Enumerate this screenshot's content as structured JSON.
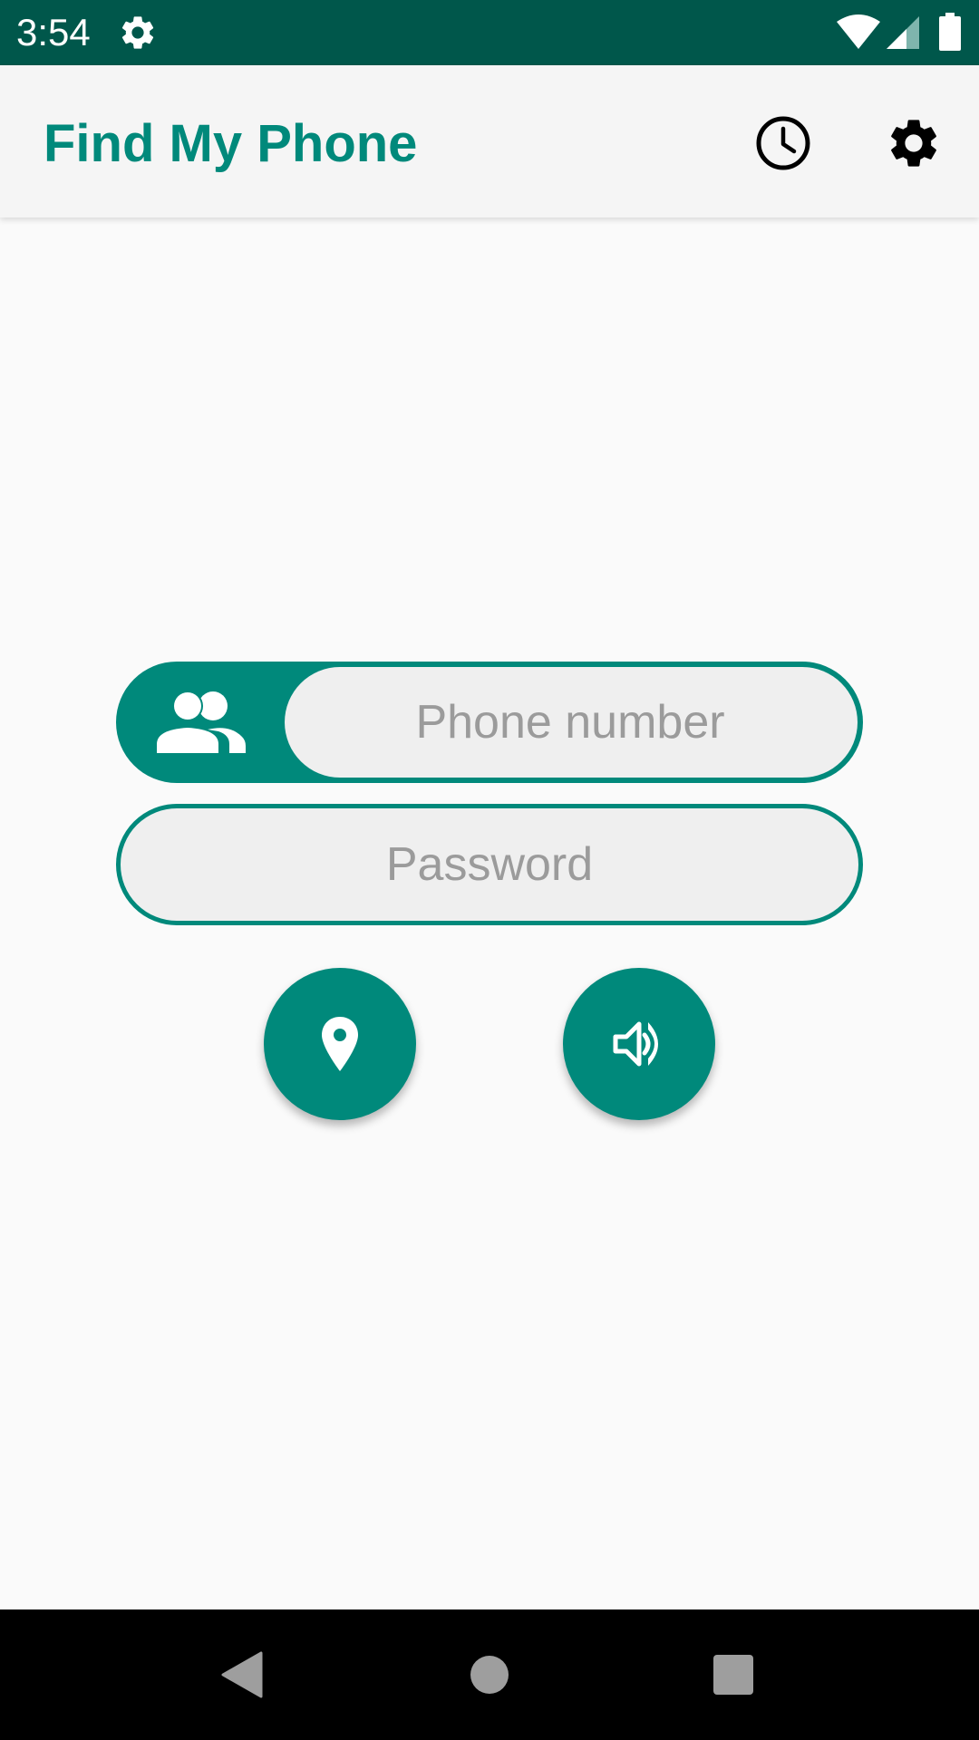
{
  "status_bar": {
    "time": "3:54",
    "icons": [
      "settings-icon",
      "wifi-icon",
      "cell-signal-icon",
      "battery-icon"
    ],
    "background_color": "#00574b"
  },
  "app_bar": {
    "title": "Find My Phone",
    "actions": [
      "history-icon",
      "settings-icon"
    ],
    "title_color": "#00897b"
  },
  "form": {
    "phone_placeholder": "Phone number",
    "password_placeholder": "Password",
    "contacts_icon": "contacts-icon",
    "accent_color": "#00897b"
  },
  "actions": {
    "locate_icon": "location-pin-icon",
    "ring_icon": "volume-up-icon"
  },
  "nav_bar": {
    "buttons": [
      "back-icon",
      "home-icon",
      "recents-icon"
    ]
  }
}
